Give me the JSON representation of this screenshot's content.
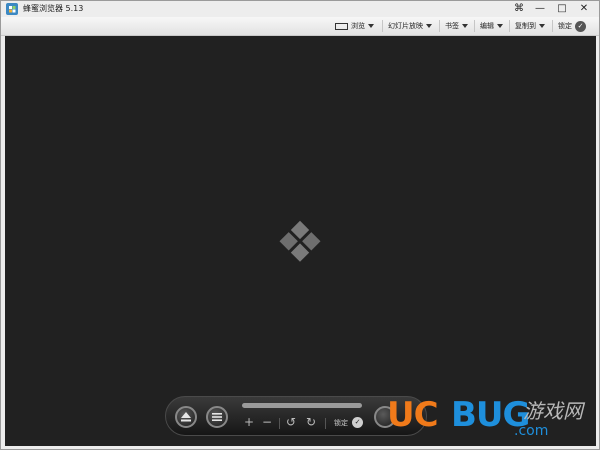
{
  "window": {
    "title": "蜂蜜浏览器 5.13",
    "controls": {
      "pin": "⌘",
      "minimize": "—",
      "maximize": "□",
      "close": "✕"
    }
  },
  "toolbar": {
    "browse": "浏览",
    "slideshow": "幻灯片放映",
    "bookmark": "书签",
    "edit": "编辑",
    "copy_to": "复制到",
    "lock": "锁定"
  },
  "controls": {
    "eject_icon": "eject-icon",
    "menu_icon": "menu-icon",
    "zoom_in": "+",
    "zoom_out": "−",
    "rotate_left": "↺",
    "rotate_right": "↻",
    "lock": "锁定"
  },
  "watermark": {
    "uc": "UC",
    "bug": "BUG",
    "cn": "游戏网",
    "com": ".com"
  },
  "colors": {
    "viewer_bg": "#212121",
    "watermark_orange": "#f07a1a",
    "watermark_blue": "#1e8fdc"
  }
}
